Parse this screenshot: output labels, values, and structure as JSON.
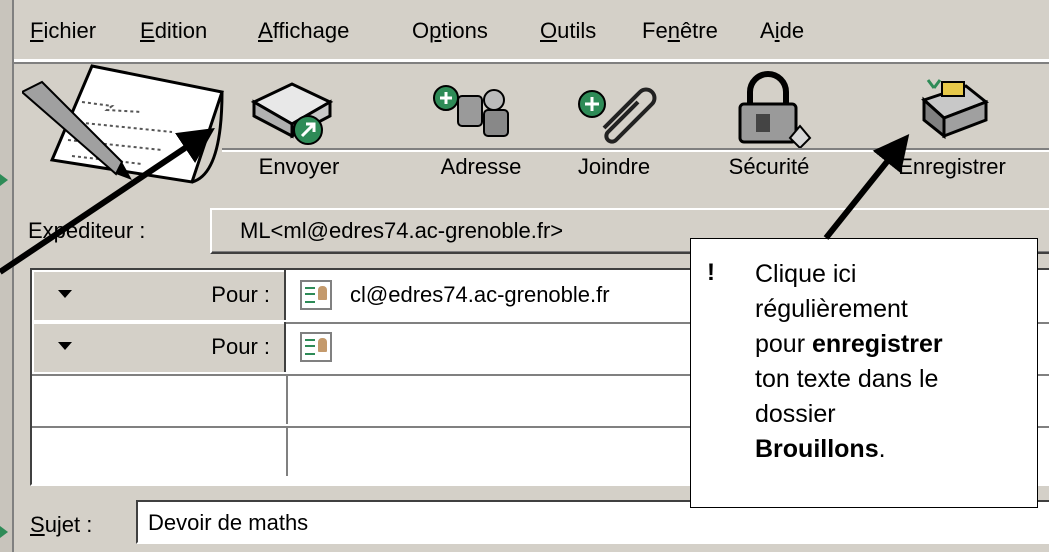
{
  "menu": [
    {
      "pre": "",
      "u": "F",
      "post": "ichier"
    },
    {
      "pre": "",
      "u": "E",
      "post": "dition"
    },
    {
      "pre": "",
      "u": "A",
      "post": "ffichage"
    },
    {
      "pre": "O",
      "u": "p",
      "post": "tions"
    },
    {
      "pre": "",
      "u": "O",
      "post": "utils"
    },
    {
      "pre": "Fe",
      "u": "n",
      "post": "être"
    },
    {
      "pre": "A",
      "u": "i",
      "post": "de"
    }
  ],
  "toolbar": {
    "send": "Envoyer",
    "address": "Adresse",
    "attach": "Joindre",
    "security": "Sécurité",
    "save": "Enregistrer"
  },
  "sender": {
    "label": "Expéditeur :",
    "value": "ML<ml@edres74.ac-grenoble.fr>"
  },
  "recipients": [
    {
      "type": "Pour :",
      "value": "cl@edres74.ac-grenoble.fr"
    },
    {
      "type": "Pour :",
      "value": ""
    }
  ],
  "subject": {
    "label_u": "S",
    "label_rest": "ujet :",
    "value": "Devoir de maths"
  },
  "callout": {
    "mark": "!",
    "line1": "Clique ici",
    "line2": "régulièrement",
    "line3_pre": "pour ",
    "line3_bold": "enregistrer",
    "line4": "ton texte dans le",
    "line5": "dossier",
    "line6_bold": "Brouillons",
    "line6_post": "."
  },
  "colors": {
    "window_bg": "#d4d0c8",
    "accent_green": "#2e8b57",
    "arrow": "#000000"
  },
  "icons": [
    "compose-pen-icon",
    "send-envelope-icon",
    "address-book-icon",
    "paperclip-icon",
    "padlock-icon",
    "save-floppy-icon",
    "vcard-icon"
  ]
}
